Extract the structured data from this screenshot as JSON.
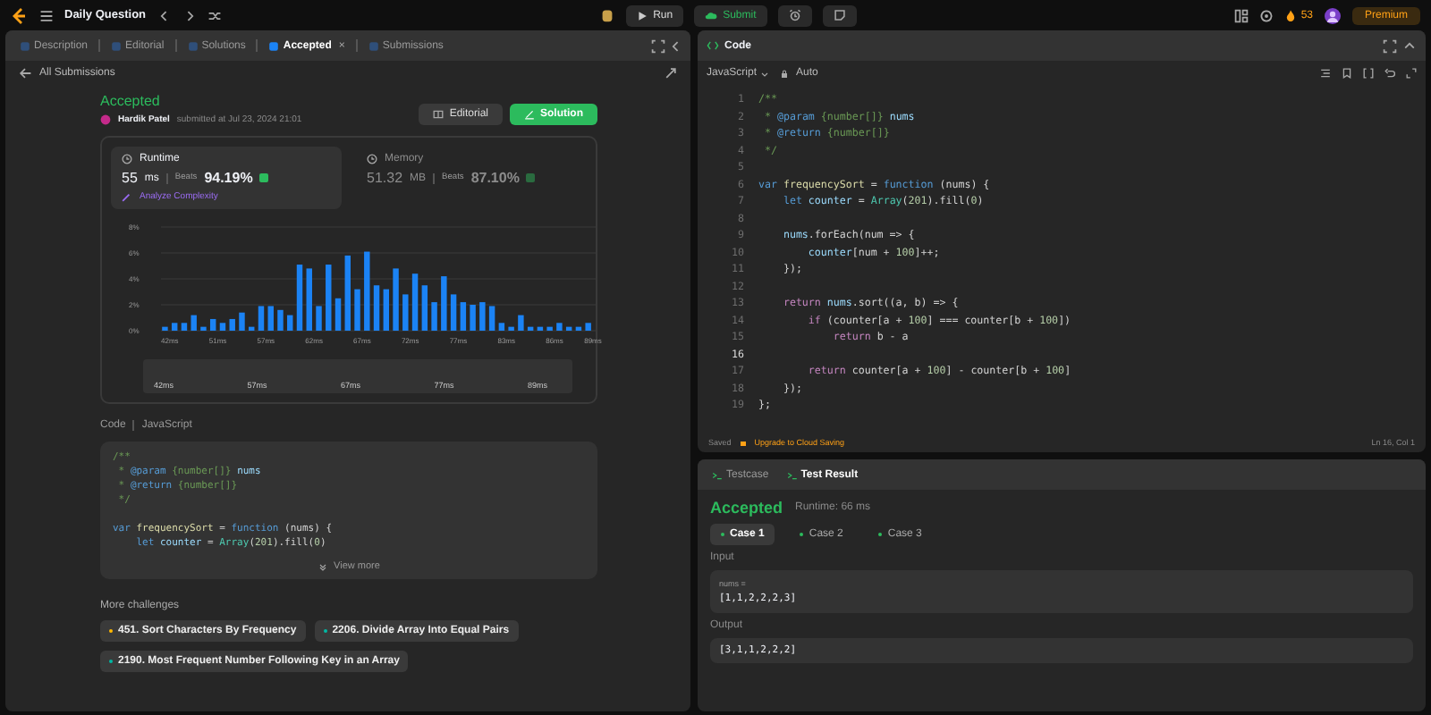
{
  "topbar": {
    "title": "Daily Question",
    "run": "Run",
    "submit": "Submit",
    "streak": "53",
    "premium": "Premium"
  },
  "left_tabs": [
    {
      "label": "Description",
      "selected": false
    },
    {
      "label": "Editorial",
      "selected": false
    },
    {
      "label": "Solutions",
      "selected": false
    },
    {
      "label": "Accepted",
      "selected": true,
      "close": "×"
    },
    {
      "label": "Submissions",
      "selected": false
    }
  ],
  "back_link": "All Submissions",
  "submission": {
    "status": "Accepted",
    "author": "Hardik Patel",
    "submitted": "submitted at Jul 23, 2024 21:01",
    "editorial_button": "Editorial",
    "solution_button": "Solution"
  },
  "stats": [
    {
      "title": "Runtime",
      "selected": true,
      "value": "55",
      "unit": "ms",
      "beats_label": "Beats",
      "beats": "94.19%",
      "extra": "Analyze Complexity"
    },
    {
      "title": "Memory",
      "selected": false,
      "value": "51.32",
      "unit": "MB",
      "beats_label": "Beats",
      "beats": "87.10%"
    }
  ],
  "chart_data": {
    "type": "bar",
    "grid": true,
    "ylim": [
      0,
      8
    ],
    "yticks": [
      {
        "value": 0,
        "label": "0%"
      },
      {
        "value": 2,
        "label": "2%"
      },
      {
        "value": 4,
        "label": "4%"
      },
      {
        "value": 6,
        "label": "6%"
      },
      {
        "value": 8,
        "label": "8%"
      }
    ],
    "categories": [
      "42ms",
      null,
      null,
      null,
      null,
      "51ms",
      null,
      null,
      null,
      null,
      "57ms",
      null,
      null,
      null,
      null,
      "62ms",
      null,
      null,
      null,
      null,
      "67ms",
      null,
      null,
      null,
      null,
      "72ms",
      null,
      null,
      null,
      null,
      "77ms",
      null,
      null,
      null,
      null,
      "83ms",
      null,
      null,
      null,
      null,
      "86ms",
      null,
      null,
      null,
      "89ms"
    ],
    "values": [
      0.3,
      0.6,
      0.6,
      1.2,
      0.3,
      0.9,
      0.6,
      0.9,
      1.4,
      0.3,
      1.9,
      1.9,
      1.6,
      1.2,
      5.1,
      4.8,
      1.9,
      5.1,
      2.5,
      5.8,
      3.2,
      6.1,
      3.5,
      3.2,
      4.8,
      2.8,
      4.4,
      3.5,
      2.2,
      4.2,
      2.8,
      2.2,
      2.0,
      2.2,
      1.9,
      0.6,
      0.3,
      1.2,
      0.3,
      0.3,
      0.3,
      0.6,
      0.3,
      0.3,
      0.6
    ]
  },
  "range_labels": [
    "42ms",
    "57ms",
    "67ms",
    "77ms",
    "89ms"
  ],
  "code_section": {
    "label": "Code",
    "language": "JavaScript",
    "view_more": "View more"
  },
  "preview_lines": [
    {
      "kind": "code",
      "tokens": [
        {
          "kind": "comment",
          "text": "/**"
        }
      ]
    },
    {
      "kind": "code",
      "tokens": [
        {
          "kind": "comment",
          "text": " * "
        },
        {
          "kind": "tag",
          "text": "@param"
        },
        {
          "kind": "comment",
          "text": " {number[]} "
        },
        {
          "kind": "variable",
          "text": "nums"
        }
      ]
    },
    {
      "kind": "code",
      "tokens": [
        {
          "kind": "comment",
          "text": " * "
        },
        {
          "kind": "tag",
          "text": "@return"
        },
        {
          "kind": "comment",
          "text": " {number[]}"
        }
      ]
    },
    {
      "kind": "code",
      "tokens": [
        {
          "kind": "comment",
          "text": " */"
        }
      ]
    },
    {
      "kind": "blank"
    },
    {
      "kind": "code",
      "tokens": [
        {
          "kind": "keyword",
          "text": "var "
        },
        {
          "kind": "function",
          "text": "frequencySort"
        },
        {
          "kind": "plain",
          "text": " = "
        },
        {
          "kind": "keyword",
          "text": "function"
        },
        {
          "kind": "plain",
          "text": " (nums) {"
        }
      ]
    },
    {
      "kind": "code",
      "tokens": [
        {
          "kind": "keyword",
          "text": "    let "
        },
        {
          "kind": "variable",
          "text": "counter"
        },
        {
          "kind": "plain",
          "text": " = "
        },
        {
          "kind": "class",
          "text": "Array"
        },
        {
          "kind": "plain",
          "text": "("
        },
        {
          "kind": "number",
          "text": "201"
        },
        {
          "kind": "plain",
          "text": ").fill("
        },
        {
          "kind": "number",
          "text": "0"
        },
        {
          "kind": "plain",
          "text": ")"
        }
      ]
    }
  ],
  "challenges_title": "More challenges",
  "challenges": [
    {
      "label": "451. Sort Characters By Frequency",
      "color": "#ffb800"
    },
    {
      "label": "2206. Divide Array Into Equal Pairs",
      "color": "#00b8a3"
    },
    {
      "label": "2190. Most Frequent Number Following Key in an Array",
      "color": "#00b8a3"
    }
  ],
  "code_panel": {
    "title": "Code",
    "language": "JavaScript",
    "mode": "Auto",
    "saved": "Saved",
    "upgrade": "Upgrade to Cloud Saving",
    "cursor": "Ln 16, Col 1"
  },
  "editor_lines": [
    {
      "n": "1",
      "current": false,
      "tokens": [
        {
          "kind": "comment",
          "text": "/**"
        }
      ]
    },
    {
      "n": "2",
      "current": false,
      "tokens": [
        {
          "kind": "comment",
          "text": " * "
        },
        {
          "kind": "tag",
          "text": "@param"
        },
        {
          "kind": "comment",
          "text": " {number[]} "
        },
        {
          "kind": "variable",
          "text": "nums"
        }
      ]
    },
    {
      "n": "3",
      "current": false,
      "tokens": [
        {
          "kind": "comment",
          "text": " * "
        },
        {
          "kind": "tag",
          "text": "@return"
        },
        {
          "kind": "comment",
          "text": " {number[]}"
        }
      ]
    },
    {
      "n": "4",
      "current": false,
      "tokens": [
        {
          "kind": "comment",
          "text": " */"
        }
      ]
    },
    {
      "n": "5",
      "current": false
    },
    {
      "n": "6",
      "current": false,
      "tokens": [
        {
          "kind": "keyword",
          "text": "var "
        },
        {
          "kind": "function",
          "text": "frequencySort"
        },
        {
          "kind": "plain",
          "text": " = "
        },
        {
          "kind": "keyword",
          "text": "function"
        },
        {
          "kind": "plain",
          "text": " (nums) {"
        }
      ]
    },
    {
      "n": "7",
      "current": false,
      "tokens": [
        {
          "kind": "keyword",
          "text": "    let "
        },
        {
          "kind": "variable",
          "text": "counter"
        },
        {
          "kind": "plain",
          "text": " = "
        },
        {
          "kind": "class",
          "text": "Array"
        },
        {
          "kind": "plain",
          "text": "("
        },
        {
          "kind": "number",
          "text": "201"
        },
        {
          "kind": "plain",
          "text": ").fill("
        },
        {
          "kind": "number",
          "text": "0"
        },
        {
          "kind": "plain",
          "text": ")"
        }
      ]
    },
    {
      "n": "8",
      "current": false
    },
    {
      "n": "9",
      "current": false,
      "tokens": [
        {
          "kind": "variable",
          "text": "    nums"
        },
        {
          "kind": "plain",
          "text": ".forEach(num => {"
        }
      ]
    },
    {
      "n": "10",
      "current": false,
      "tokens": [
        {
          "kind": "variable",
          "text": "        counter"
        },
        {
          "kind": "plain",
          "text": "[num + "
        },
        {
          "kind": "number",
          "text": "100"
        },
        {
          "kind": "plain",
          "text": "]++;"
        }
      ]
    },
    {
      "n": "11",
      "current": false,
      "tokens": [
        {
          "kind": "plain",
          "text": "    });"
        }
      ]
    },
    {
      "n": "12",
      "current": false
    },
    {
      "n": "13",
      "current": false,
      "tokens": [
        {
          "kind": "control",
          "text": "    return "
        },
        {
          "kind": "variable",
          "text": "nums"
        },
        {
          "kind": "plain",
          "text": ".sort((a, b) => {"
        }
      ]
    },
    {
      "n": "14",
      "current": false,
      "tokens": [
        {
          "kind": "control",
          "text": "        if "
        },
        {
          "kind": "plain",
          "text": "(counter[a + "
        },
        {
          "kind": "number",
          "text": "100"
        },
        {
          "kind": "plain",
          "text": "] === counter[b + "
        },
        {
          "kind": "number",
          "text": "100"
        },
        {
          "kind": "plain",
          "text": "])"
        }
      ]
    },
    {
      "n": "15",
      "current": false,
      "tokens": [
        {
          "kind": "control",
          "text": "            return "
        },
        {
          "kind": "plain",
          "text": "b - a"
        }
      ]
    },
    {
      "n": "16",
      "current": true
    },
    {
      "n": "17",
      "current": false,
      "tokens": [
        {
          "kind": "control",
          "text": "        return "
        },
        {
          "kind": "plain",
          "text": "counter[a + "
        },
        {
          "kind": "number",
          "text": "100"
        },
        {
          "kind": "plain",
          "text": "] - counter[b + "
        },
        {
          "kind": "number",
          "text": "100"
        },
        {
          "kind": "plain",
          "text": "]"
        }
      ]
    },
    {
      "n": "18",
      "current": false,
      "tokens": [
        {
          "kind": "plain",
          "text": "    });"
        }
      ]
    },
    {
      "n": "19",
      "current": false,
      "tokens": [
        {
          "kind": "plain",
          "text": "};"
        }
      ]
    }
  ],
  "bottom_tabs": [
    {
      "label": "Testcase",
      "selected": false
    },
    {
      "label": "Test Result",
      "selected": true
    }
  ],
  "result": {
    "status": "Accepted",
    "runtime": "Runtime: 66 ms"
  },
  "cases": [
    {
      "label": "Case 1",
      "selected": true
    },
    {
      "label": "Case 2",
      "selected": false
    },
    {
      "label": "Case 3",
      "selected": false
    }
  ],
  "input": {
    "label": "Input",
    "var": "nums =",
    "value": "[1,1,2,2,2,3]"
  },
  "output": {
    "label": "Output",
    "value": "[3,1,1,2,2,2]"
  }
}
